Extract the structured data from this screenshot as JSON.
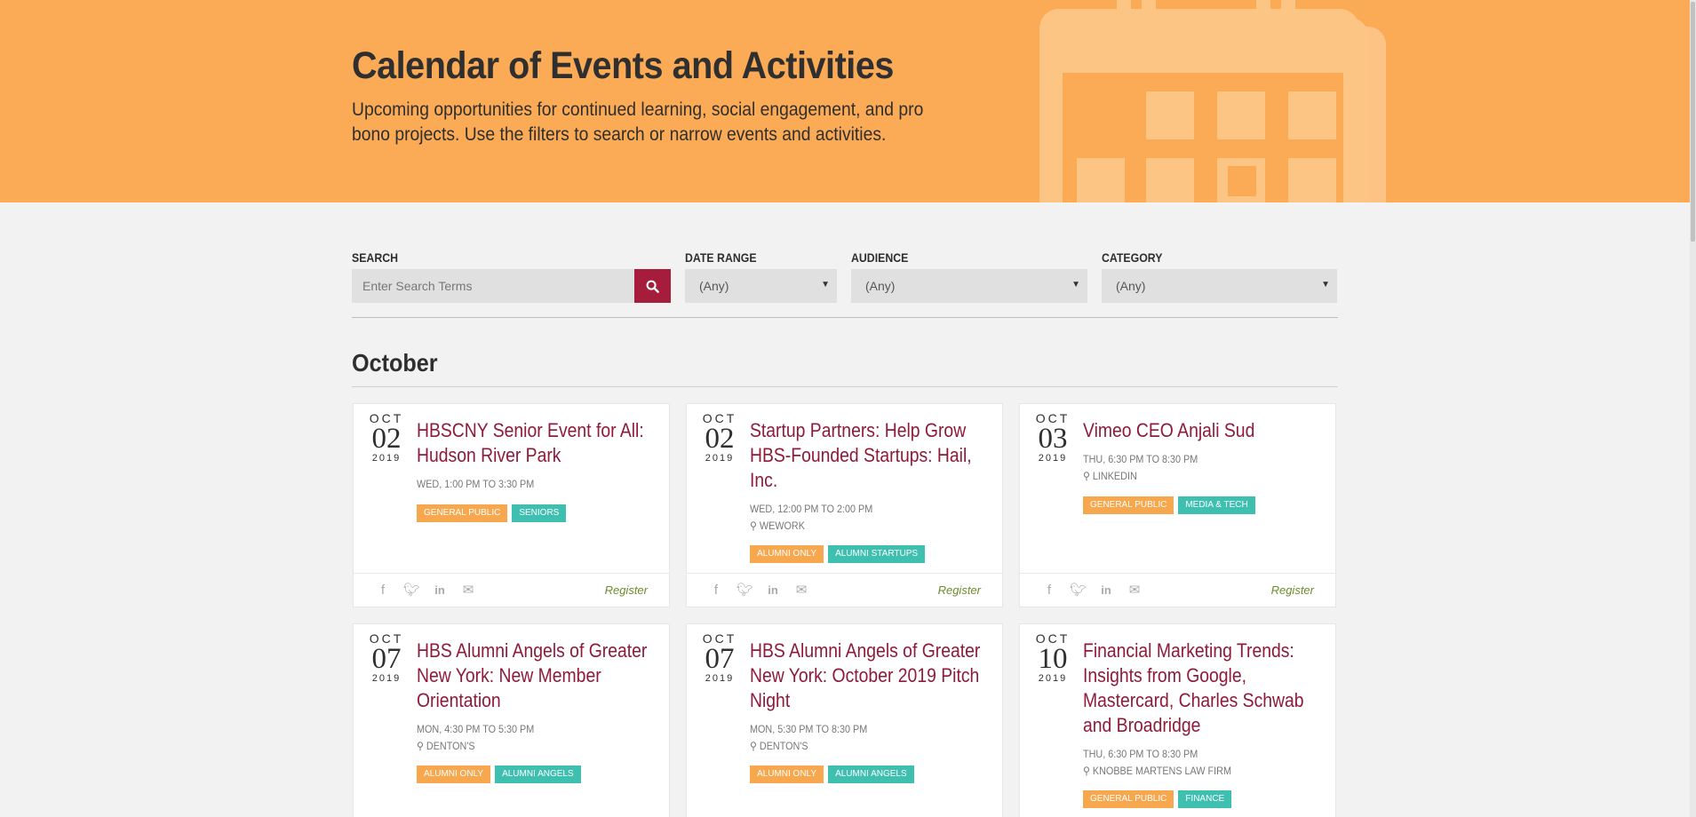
{
  "hero": {
    "title": "Calendar of Events and Activities",
    "subtitle": "Upcoming opportunities for continued learning, social engagement, and pro bono projects. Use the filters to search or narrow events and activities.",
    "bg_color": "#fbaa55"
  },
  "filters": {
    "search_label": "SEARCH",
    "search_placeholder": "Enter Search Terms",
    "date_label": "DATE RANGE",
    "date_value": "(Any)",
    "audience_label": "AUDIENCE",
    "audience_value": "(Any)",
    "category_label": "CATEGORY",
    "category_value": "(Any)"
  },
  "month": "October",
  "register_label": "Register",
  "events": [
    {
      "mon": "OCT",
      "day": "02",
      "year": "2019",
      "title": "HBSCNY Senior Event for All: Hudson River Park",
      "time": "WED, 1:00 PM TO 3:30 PM",
      "location": "",
      "tags": [
        {
          "label": "GENERAL PUBLIC",
          "kind": "o"
        },
        {
          "label": "SENIORS",
          "kind": "t"
        }
      ]
    },
    {
      "mon": "OCT",
      "day": "02",
      "year": "2019",
      "title": "Startup Partners: Help Grow HBS-Founded Startups: Hail, Inc.",
      "time": "WED, 12:00 PM TO 2:00 PM",
      "location": "WEWORK",
      "tags": [
        {
          "label": "ALUMNI ONLY",
          "kind": "o"
        },
        {
          "label": "ALUMNI STARTUPS",
          "kind": "t"
        }
      ]
    },
    {
      "mon": "OCT",
      "day": "03",
      "year": "2019",
      "title": "Vimeo CEO Anjali Sud",
      "time": "THU, 6:30 PM TO 8:30 PM",
      "location": "LINKEDIN",
      "tags": [
        {
          "label": "GENERAL PUBLIC",
          "kind": "o"
        },
        {
          "label": "MEDIA & TECH",
          "kind": "t"
        }
      ]
    },
    {
      "mon": "OCT",
      "day": "07",
      "year": "2019",
      "title": "HBS Alumni Angels of Greater New York: New Member Orientation",
      "time": "MON, 4:30 PM TO 5:30 PM",
      "location": "DENTON'S",
      "tags": [
        {
          "label": "ALUMNI ONLY",
          "kind": "o"
        },
        {
          "label": "ALUMNI ANGELS",
          "kind": "t"
        }
      ]
    },
    {
      "mon": "OCT",
      "day": "07",
      "year": "2019",
      "title": "HBS Alumni Angels of Greater New York: October 2019 Pitch Night",
      "time": "MON, 5:30 PM TO 8:30 PM",
      "location": "DENTON'S",
      "tags": [
        {
          "label": "ALUMNI ONLY",
          "kind": "o"
        },
        {
          "label": "ALUMNI ANGELS",
          "kind": "t"
        }
      ]
    },
    {
      "mon": "OCT",
      "day": "10",
      "year": "2019",
      "title": "Financial Marketing Trends: Insights from Google, Mastercard, Charles Schwab and Broadridge",
      "time": "THU, 6:30 PM TO 8:30 PM",
      "location": "KNOBBE MARTENS LAW FIRM",
      "tags": [
        {
          "label": "GENERAL PUBLIC",
          "kind": "o"
        },
        {
          "label": "FINANCE",
          "kind": "t"
        }
      ]
    }
  ]
}
